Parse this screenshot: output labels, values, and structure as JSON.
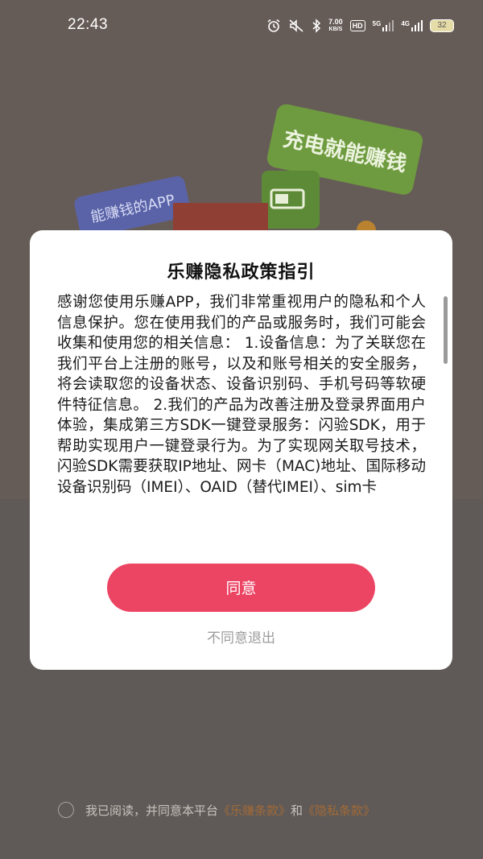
{
  "status_bar": {
    "time": "22:43",
    "net_speed_value": "7.00",
    "net_speed_unit": "KB/S",
    "hd_badge": "HD",
    "signal1_label": "5G",
    "signal2_label": "4G",
    "battery": "32",
    "icons": [
      "alarm-icon",
      "mute-icon",
      "bluetooth-icon",
      "signal-icon",
      "battery-icon"
    ]
  },
  "background": {
    "banner_right": "充电就能赚钱",
    "banner_left": "能赚钱的APP"
  },
  "dialog": {
    "title": "乐赚隐私政策指引",
    "body": "感谢您使用乐赚APP，我们非常重视用户的隐私和个人信息保护。您在使用我们的产品或服务时，我们可能会收集和使用您的相关信息：  1.设备信息：为了关联您在我们平台上注册的账号，以及和账号相关的安全服务，将会读取您的设备状态、设备识别码、手机号码等软硬件特征信息。 2.我们的产品为改善注册及登录界面用户体验，集成第三方SDK一键登录服务：闪验SDK，用于帮助实现用户一键登录行为。为了实现网关取号技术，闪验SDK需要获取IP地址、网卡（MAC)地址、国际移动设备识别码（IMEI）、OAID（替代IMEI）、sim卡",
    "agree_label": "同意",
    "decline_label": "不同意退出"
  },
  "consent": {
    "prefix": "我已阅读，并同意本平台",
    "terms_link": "《乐赚条款》",
    "conjunction": "和",
    "privacy_link": "《隐私条款》"
  },
  "colors": {
    "accent": "#ec4564",
    "link": "#a36a37",
    "backdrop": "#5f5a57"
  }
}
